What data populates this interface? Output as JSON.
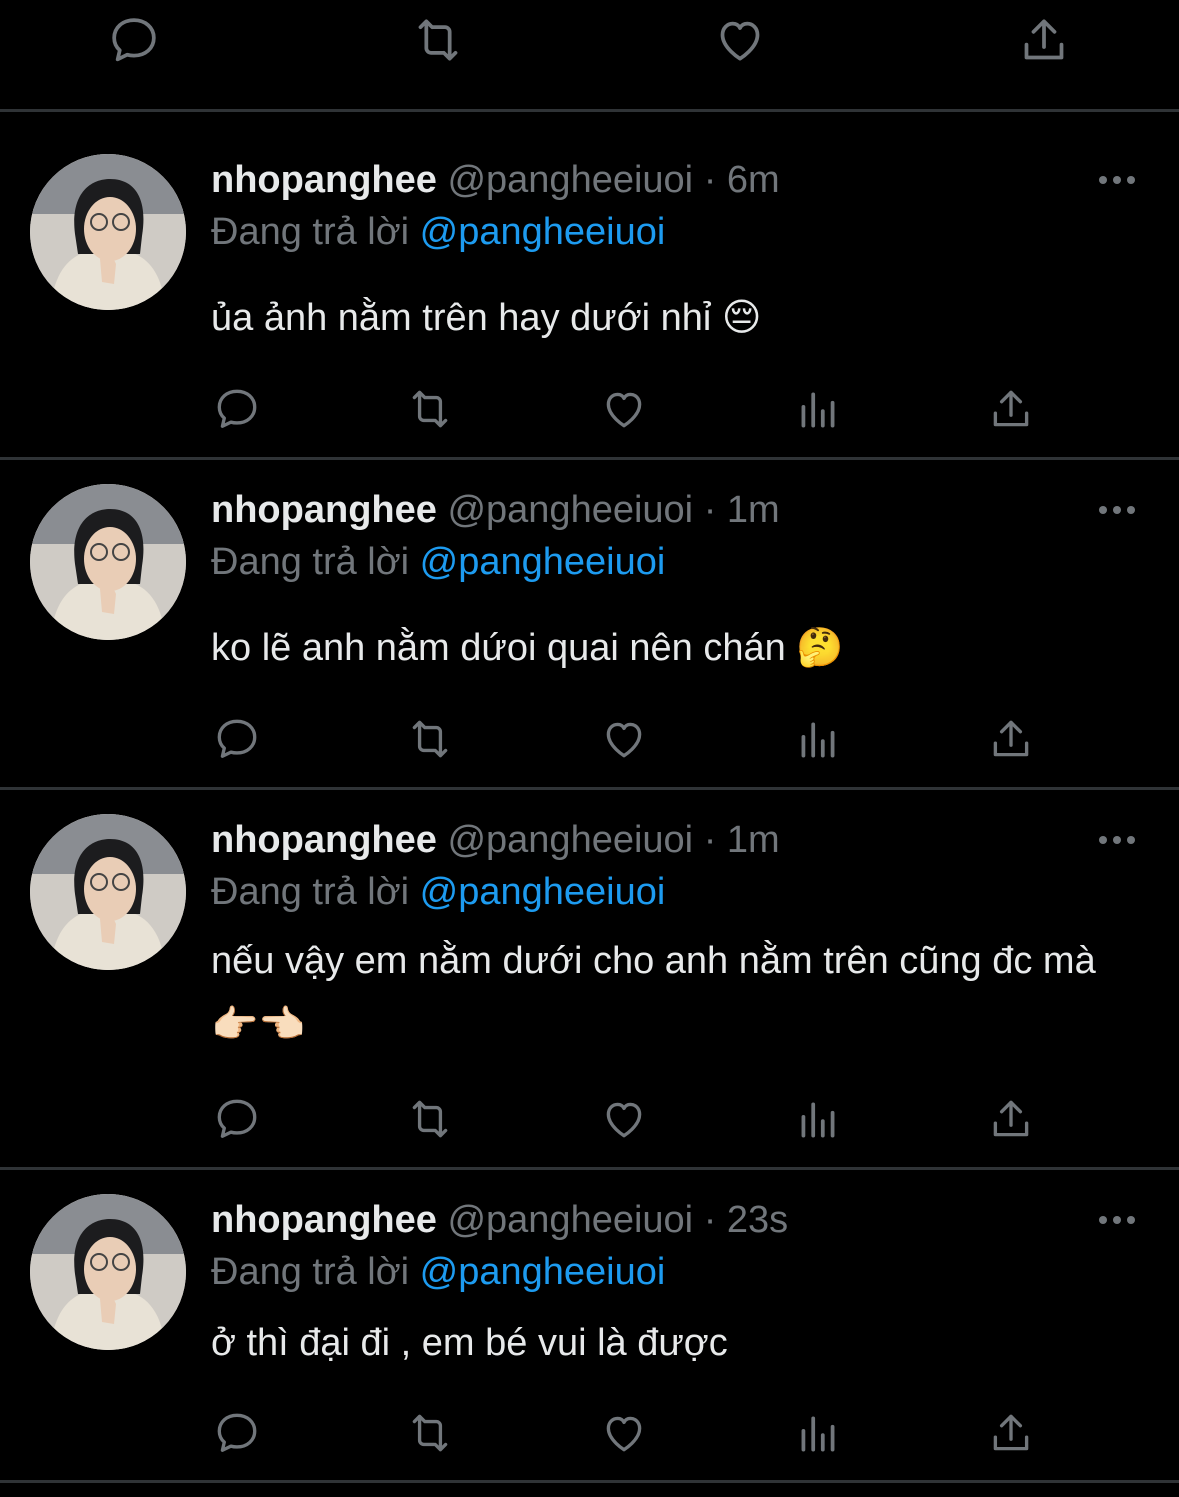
{
  "colors": {
    "background": "#000000",
    "divider": "#2f3336",
    "primary_text": "#e7e9ea",
    "secondary_text": "#71767b",
    "link": "#1d9bf0"
  },
  "top_actions": [
    "reply-icon",
    "retweet-icon",
    "like-icon",
    "share-icon"
  ],
  "tweet_actions": [
    "reply-icon",
    "retweet-icon",
    "like-icon",
    "views-icon",
    "share-icon"
  ],
  "tweets": [
    {
      "name": "nhopanghee",
      "handle": "@pangheeiuoi",
      "dot": "·",
      "time": "6m",
      "reply_prefix": "Đang trả lời",
      "reply_handle": "@pangheeiuoi",
      "text": "ủa ảnh nằm trên hay dưới nhỉ 😔"
    },
    {
      "name": "nhopanghee",
      "handle": "@pangheeiuoi",
      "dot": "·",
      "time": "1m",
      "reply_prefix": "Đang trả lời",
      "reply_handle": "@pangheeiuoi",
      "text": "ko lẽ anh nằm dứoi quai nên chán 🤔"
    },
    {
      "name": "nhopanghee",
      "handle": "@pangheeiuoi",
      "dot": "·",
      "time": "1m",
      "reply_prefix": "Đang trả lời",
      "reply_handle": "@pangheeiuoi",
      "text": "nếu vậy em nằm dưới cho anh nằm trên cũng đc mà 👉🏻👈🏻"
    },
    {
      "name": "nhopanghee",
      "handle": "@pangheeiuoi",
      "dot": "·",
      "time": "23s",
      "reply_prefix": "Đang trả lời",
      "reply_handle": "@pangheeiuoi",
      "text": "ở thì đại đi , em bé vui là được"
    }
  ]
}
